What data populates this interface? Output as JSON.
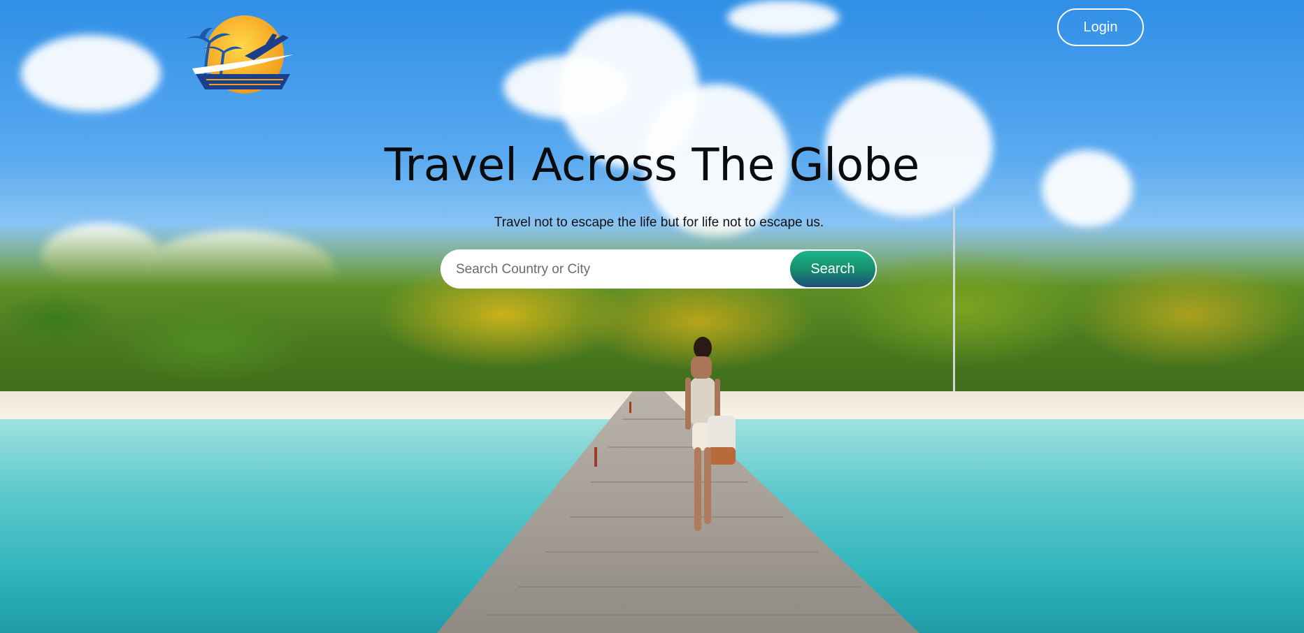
{
  "header": {
    "logo_icon": "palm-sun-plane-ship-logo",
    "login_label": "Login"
  },
  "hero": {
    "title": "Travel Across The Globe",
    "subtitle": "Travel not to escape the life but for life not to escape us.",
    "search": {
      "placeholder": "Search Country or City",
      "value": "",
      "button_label": "Search"
    }
  },
  "colors": {
    "search_button_gradient": [
      "#1fb58a",
      "#1d4f78"
    ],
    "title_text": "#0b0b0b",
    "login_border": "#ffffff"
  }
}
